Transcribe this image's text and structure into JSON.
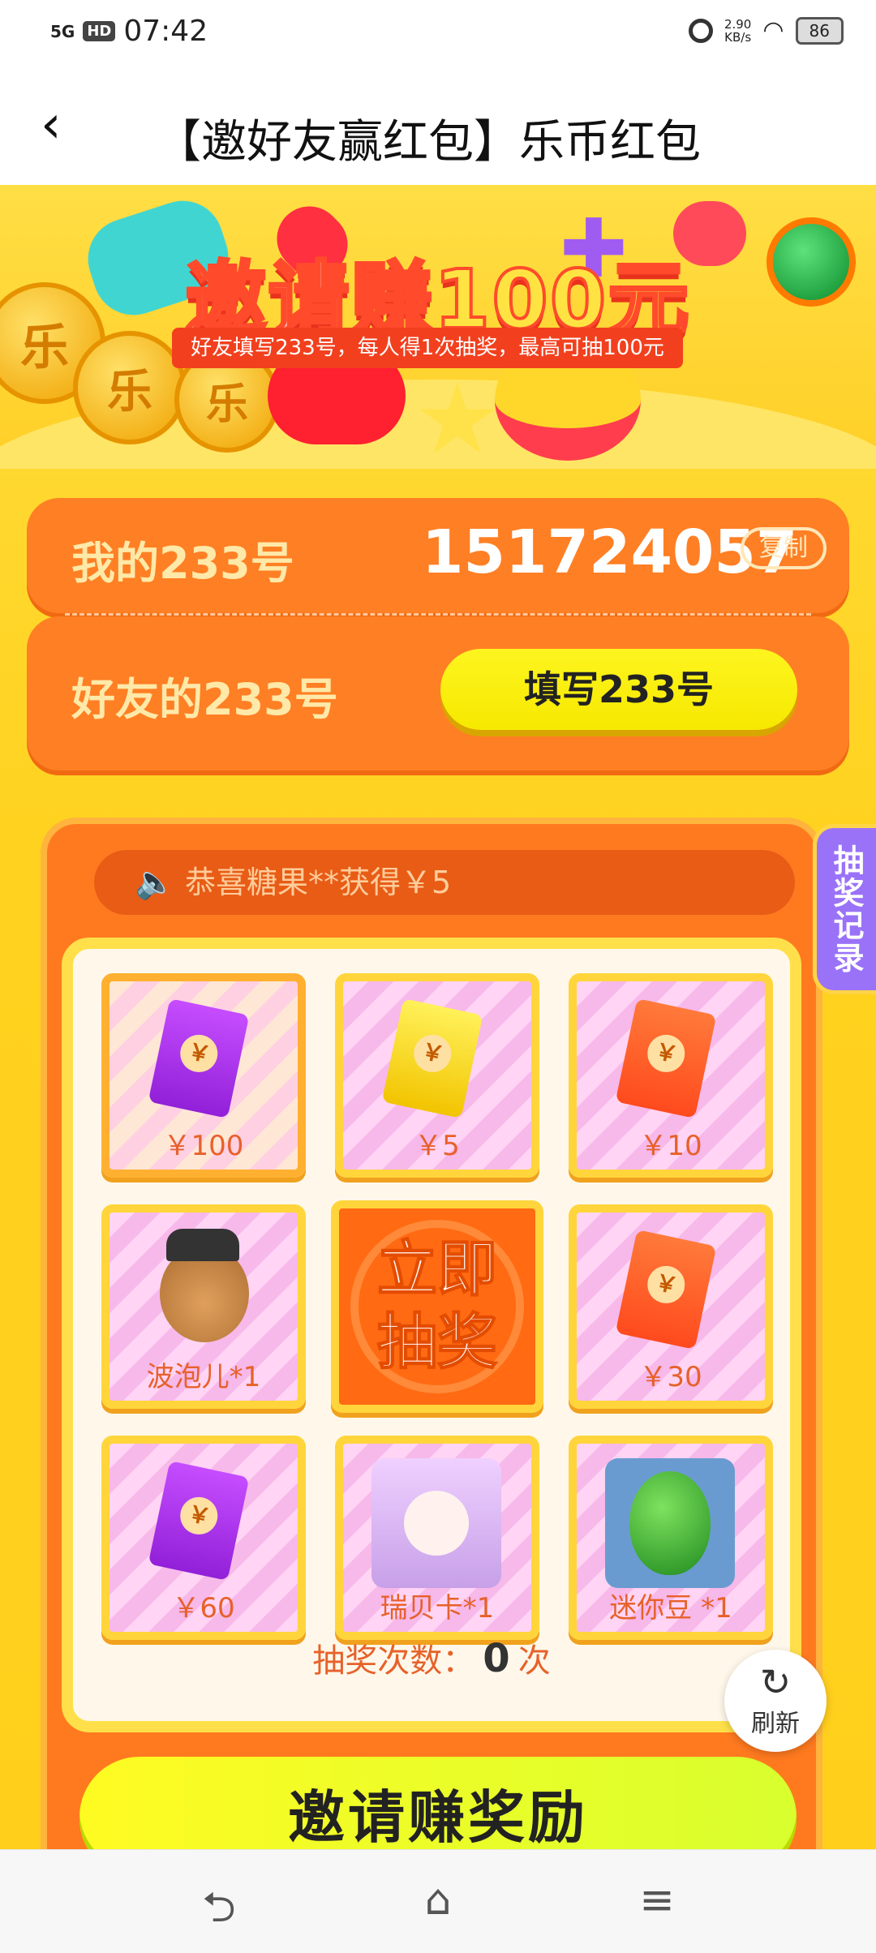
{
  "status_bar": {
    "network": "5G",
    "hd": "HD",
    "time": "07:42",
    "net_speed_value": "2.90",
    "net_speed_unit": "KB/s",
    "battery": "86"
  },
  "header": {
    "back_icon": "‹",
    "title": "【邀好友赢红包】乐币红包"
  },
  "banner": {
    "title_part1": "邀请赚",
    "title_part2": "100元",
    "subtitle": "好友填写233号，每人得1次抽奖，最高可抽100元",
    "coin_glyph": "乐"
  },
  "my_id_card": {
    "label": "我的233号",
    "value": "151724057",
    "copy_label": "复制"
  },
  "friend_card": {
    "label": "好友的233号",
    "button_label": "填写233号"
  },
  "lottery": {
    "notice": "恭喜糖果**获得￥5",
    "prizes": [
      {
        "label": "￥100",
        "icon": "purple-red-envelope-icon"
      },
      {
        "label": "￥5",
        "icon": "yellow-red-envelope-icon"
      },
      {
        "label": "￥10",
        "icon": "red-envelope-icon"
      },
      {
        "label": "波泡儿*1",
        "icon": "pirate-dog-icon"
      },
      {
        "label": "￥30",
        "icon": "red-envelope-icon"
      },
      {
        "label": "￥60",
        "icon": "purple-red-envelope-icon"
      },
      {
        "label": "瑞贝卡*1",
        "icon": "character-portrait-icon"
      },
      {
        "label": "迷你豆 *1",
        "icon": "green-egg-icon"
      }
    ],
    "envelope_seal": "￥",
    "center_button_line1": "立即",
    "center_button_line2": "抽奖",
    "count_prefix": "抽奖次数：",
    "count_value": "0",
    "count_suffix": "次"
  },
  "side_tab": {
    "label": "抽奖记录"
  },
  "refresh": {
    "icon": "↻",
    "label": "刷新"
  },
  "invite_button": {
    "label": "邀请赚奖励"
  },
  "nav_bar": {
    "back_icon": "⮌",
    "home_icon": "⌂",
    "menu_icon": "≡"
  },
  "colors": {
    "panel_orange": "#ff7f24",
    "highlight_yellow": "#ffe04a",
    "accent_purple": "#9a72f8"
  }
}
